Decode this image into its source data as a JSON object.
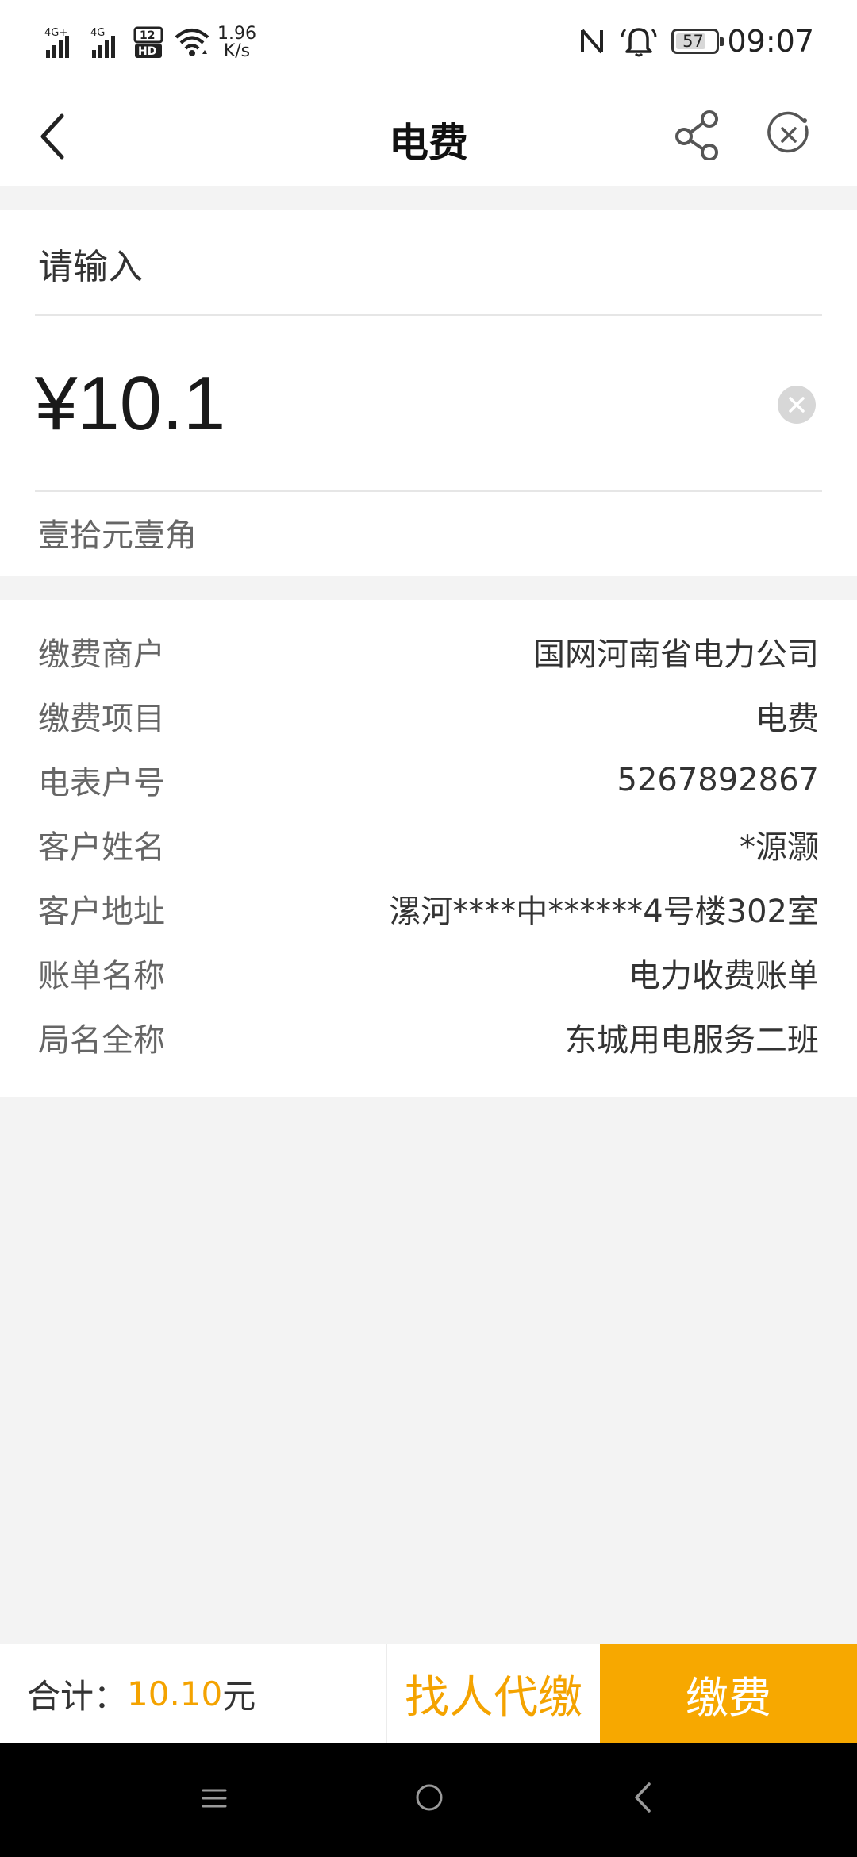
{
  "status_bar": {
    "network_1": "4G+",
    "network_2": "4G",
    "hd_label": "HD",
    "speed_value": "1.96",
    "speed_unit": "K/s",
    "battery_level": "57",
    "time": "09:07",
    "icons": [
      "signal-4g-plus-icon",
      "signal-4g-icon",
      "dual-sim-hd-icon",
      "wifi-icon",
      "nfc-icon",
      "alarm-bell-icon",
      "battery-icon"
    ]
  },
  "nav": {
    "title": "电费",
    "icons": [
      "back-arrow-icon",
      "share-icon",
      "close-circle-icon"
    ]
  },
  "amount": {
    "label": "请输入",
    "value": "¥10.1",
    "in_words": "壹拾元壹角"
  },
  "info": {
    "rows": [
      {
        "key": "缴费商户",
        "value": "国网河南省电力公司"
      },
      {
        "key": "缴费项目",
        "value": "电费"
      },
      {
        "key": "电表户号",
        "value": "5267892867"
      },
      {
        "key": "客户姓名",
        "value": "*源灏"
      },
      {
        "key": "客户地址",
        "value": "漯河****中******4号楼302室"
      },
      {
        "key": "账单名称",
        "value": "电力收费账单"
      },
      {
        "key": "局名全称",
        "value": "东城用电服务二班"
      }
    ]
  },
  "bottom": {
    "total_label": "合计：",
    "total_value": "10.10",
    "total_unit": "元",
    "proxy_label": "找人代缴",
    "pay_label": "缴费"
  },
  "colors": {
    "accent": "#f7a800",
    "accent_text": "#f4a300",
    "background": "#f3f3f3"
  }
}
